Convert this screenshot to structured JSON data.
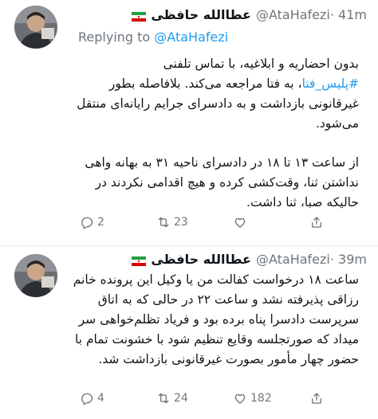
{
  "tweets": [
    {
      "display_name": "عطاالله حافظی",
      "handle": "@AtaHafezi",
      "time": "· 41m",
      "replying_to_prefix": "Replying to ",
      "replying_to_handle": "@AtaHafezi",
      "body": {
        "line1": "بدون احضاریه و ابلاغیه، با تماس تلفنی",
        "hashtag": "#پلیس_فتا",
        "line2_rest": "، به فتا مراجعه می‌کند. بلافاصله بطور غیرقانونی بازداشت و به دادسرای جرایم رایانه‌ای منتقل می‌شود.",
        "para2": "از ساعت ۱۳ تا ۱۸ در دادسرای ناحیه ۳۱ به بهانه واهی نداشتن ثنا، وقت‌کشی کرده و هیچ اقدامی نکردند در حالیکه صبا، ثنا داشت."
      },
      "actions": {
        "replies": "2",
        "retweets": "23",
        "likes": "",
        "share": ""
      }
    },
    {
      "display_name": "عطاالله حافظی",
      "handle": "@AtaHafezi",
      "time": "· 39m",
      "body": {
        "para1": "ساعت ۱۸ درخواست کفالت من یا وکیل این پرونده خانم رزاقی پذیرفته نشد و ساعت ۲۲ در حالی که به اتاق سرپرست دادسرا پناه برده بود و فریاد تظلم‌خواهی سر میداد که صورتجلسه وقایع تنظیم شود با خشونت تمام با حضور چهار مأمور بصورت غیرقانونی بازداشت شد."
      },
      "actions": {
        "replies": "4",
        "retweets": "24",
        "likes": "182",
        "share": ""
      }
    }
  ],
  "colors": {
    "link": "#1d9bf0",
    "muted": "#6e767d",
    "text": "#0f1419",
    "divider": "#e4e6e8"
  },
  "icons": [
    "avatar",
    "iran-flag-icon",
    "reply-icon",
    "retweet-icon",
    "like-icon",
    "share-icon"
  ]
}
